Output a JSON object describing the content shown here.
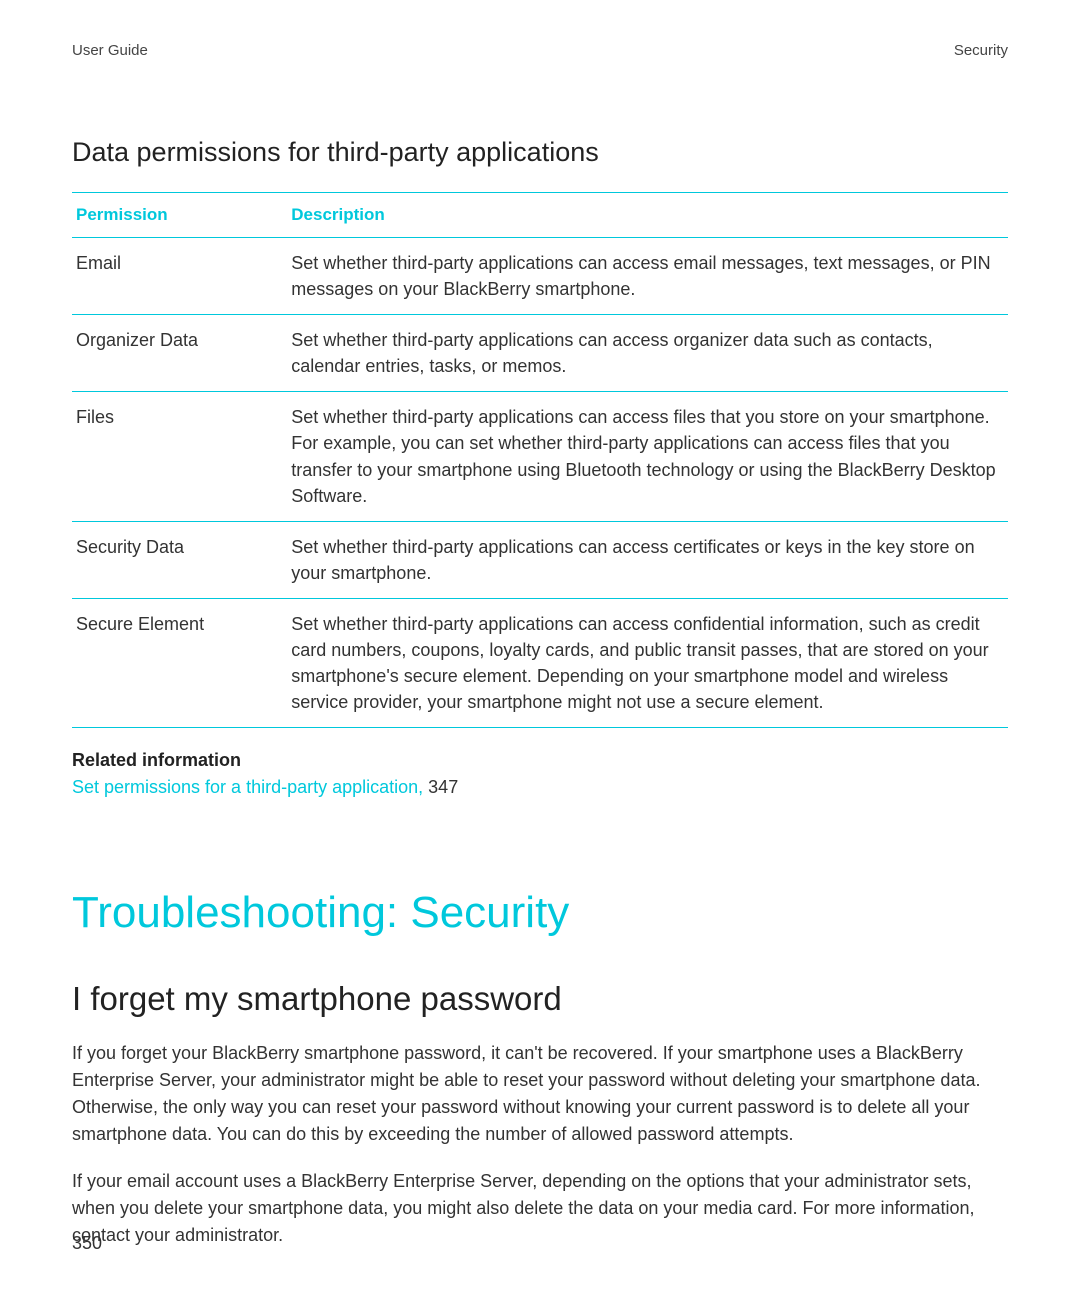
{
  "header": {
    "left": "User Guide",
    "right": "Security"
  },
  "section_heading": "Data permissions for third-party applications",
  "table": {
    "col_permission": "Permission",
    "col_description": "Description",
    "rows": [
      {
        "permission": "Email",
        "description": "Set whether third-party applications can access email messages, text messages, or PIN messages on your BlackBerry smartphone."
      },
      {
        "permission": "Organizer Data",
        "description": "Set whether third-party applications can access organizer data such as contacts, calendar entries, tasks, or memos."
      },
      {
        "permission": "Files",
        "description": "Set whether third-party applications can access files that you store on your smartphone. For example, you can set whether third-party applications can access files that you transfer to your smartphone using Bluetooth technology or using the BlackBerry Desktop Software."
      },
      {
        "permission": "Security Data",
        "description": "Set whether third-party applications can access certificates or keys in the key store on your smartphone."
      },
      {
        "permission": "Secure Element",
        "description": "Set whether third-party applications can access confidential information, such as credit card numbers, coupons, loyalty cards, and public transit passes, that are stored on your smartphone's secure element. Depending on your smartphone model and wireless service provider, your smartphone might not use a secure element."
      }
    ]
  },
  "related": {
    "heading": "Related information",
    "link_text": "Set permissions for a third-party application, ",
    "link_page": "347"
  },
  "troubleshoot_heading": "Troubleshooting: Security",
  "problem_heading": "I forget my smartphone password",
  "paragraphs": [
    "If you forget your BlackBerry smartphone password, it can't be recovered. If your smartphone uses a BlackBerry Enterprise Server, your administrator might be able to reset your password without deleting your smartphone data. Otherwise, the only way you can reset your password without knowing your current password is to delete all your smartphone data. You can do this by exceeding the number of allowed password attempts.",
    "If your email account uses a BlackBerry Enterprise Server, depending on the options that your administrator sets, when you delete your smartphone data, you might also delete the data on your media card. For more information, contact your administrator."
  ],
  "page_number": "350"
}
